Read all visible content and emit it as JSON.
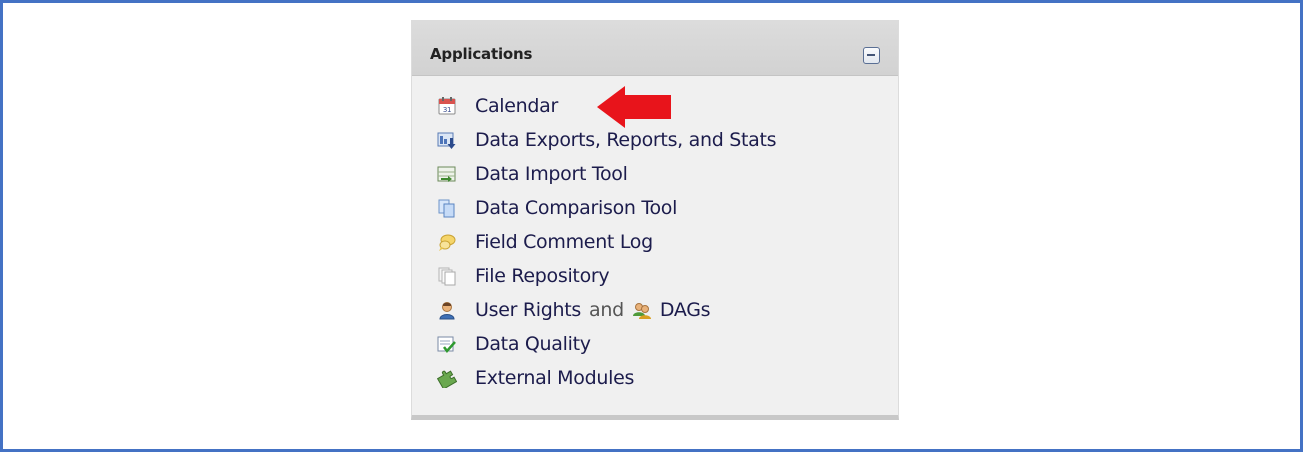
{
  "panel": {
    "title": "Applications",
    "collapse_icon": "minus-box-icon"
  },
  "menu": {
    "items": [
      {
        "label": "Calendar",
        "icon": "calendar-icon"
      },
      {
        "label": "Data Exports, Reports, and Stats",
        "icon": "data-export-icon"
      },
      {
        "label": "Data Import Tool",
        "icon": "data-import-icon"
      },
      {
        "label": "Data Comparison Tool",
        "icon": "data-comparison-icon"
      },
      {
        "label": "Field Comment Log",
        "icon": "comment-log-icon"
      },
      {
        "label": "File Repository",
        "icon": "file-repository-icon"
      },
      {
        "label": "User Rights",
        "and_text": "and",
        "label2": "DAGs",
        "icon": "user-icon",
        "icon2": "group-icon"
      },
      {
        "label": "Data Quality",
        "icon": "data-quality-icon"
      },
      {
        "label": "External Modules",
        "icon": "puzzle-icon"
      }
    ]
  },
  "annotation": {
    "arrow_icon": "red-arrow-icon",
    "arrow_color": "#e8141b"
  },
  "colors": {
    "frame_border": "#4472c4",
    "link_text": "#1c1c4c"
  }
}
